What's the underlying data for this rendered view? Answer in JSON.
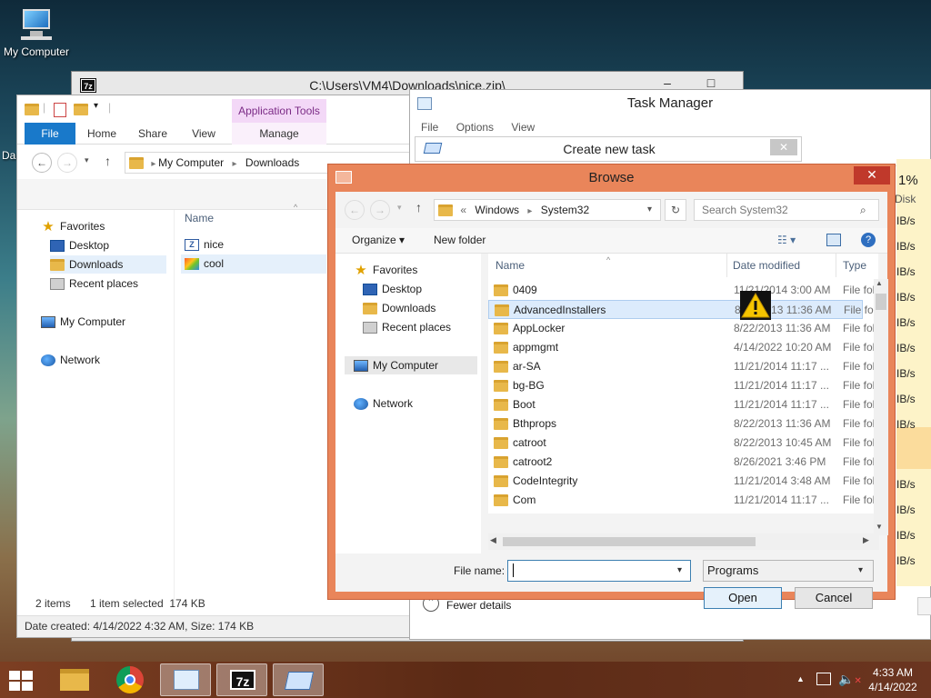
{
  "desktop": {
    "icon_label": "My Computer",
    "partial_label": "Da"
  },
  "zip_window": {
    "title": "C:\\Users\\VM4\\Downloads\\nice.zip\\",
    "logo": "7z"
  },
  "explorer": {
    "ribbon": {
      "context_group": "Application Tools",
      "tabs": [
        "File",
        "Home",
        "Share",
        "View",
        "Manage"
      ]
    },
    "breadcrumb": [
      "My Computer",
      "Downloads"
    ],
    "nav": {
      "favorites": "Favorites",
      "items": [
        "Desktop",
        "Downloads",
        "Recent places"
      ],
      "computer": "My Computer",
      "network": "Network"
    },
    "column_name": "Name",
    "files": [
      {
        "name": "nice",
        "icon": "zip-archive-icon"
      },
      {
        "name": "cool",
        "icon": "application-icon"
      }
    ],
    "status": {
      "count": "2 items",
      "selected": "1 item selected  174 KB"
    },
    "details": "Date created: 4/14/2022 4:32 AM, Size: 174 KB"
  },
  "task_manager": {
    "title": "Task Manager",
    "menu": [
      "File",
      "Options",
      "View"
    ],
    "disk_percent": "1%",
    "disk_label": "Disk",
    "speed_values": [
      "IB/s",
      "IB/s",
      "IB/s",
      "IB/s",
      "IB/s",
      "IB/s",
      "IB/s",
      "IB/s",
      "IB/s",
      "IB/s",
      "IB/s",
      "IB/s",
      "IB/s"
    ],
    "fewer_details": "Fewer details"
  },
  "create_task": {
    "title": "Create new task"
  },
  "browse": {
    "title": "Browse",
    "path": [
      "Windows",
      "System32"
    ],
    "path_prefix": "«",
    "search_placeholder": "Search System32",
    "organize": "Organize",
    "new_folder": "New folder",
    "nav": {
      "favorites": "Favorites",
      "items": [
        "Desktop",
        "Downloads",
        "Recent places"
      ],
      "computer": "My Computer",
      "network": "Network"
    },
    "columns": {
      "name": "Name",
      "date": "Date modified",
      "type": "Type"
    },
    "rows": [
      {
        "name": "0409",
        "date": "11/21/2014 3:00 AM",
        "type": "File fol"
      },
      {
        "name": "AdvancedInstallers",
        "date": "8/22/2013 11:36 AM",
        "type": "File fol"
      },
      {
        "name": "AppLocker",
        "date": "8/22/2013 11:36 AM",
        "type": "File fol"
      },
      {
        "name": "appmgmt",
        "date": "4/14/2022 10:20 AM",
        "type": "File fol"
      },
      {
        "name": "ar-SA",
        "date": "11/21/2014 11:17 ...",
        "type": "File fol"
      },
      {
        "name": "bg-BG",
        "date": "11/21/2014 11:17 ...",
        "type": "File fol"
      },
      {
        "name": "Boot",
        "date": "11/21/2014 11:17 ...",
        "type": "File fol"
      },
      {
        "name": "Bthprops",
        "date": "8/22/2013 11:36 AM",
        "type": "File fol"
      },
      {
        "name": "catroot",
        "date": "8/22/2013 10:45 AM",
        "type": "File fol"
      },
      {
        "name": "catroot2",
        "date": "8/26/2021 3:46 PM",
        "type": "File fol"
      },
      {
        "name": "CodeIntegrity",
        "date": "11/21/2014 3:48 AM",
        "type": "File fol"
      },
      {
        "name": "Com",
        "date": "11/21/2014 11:17 ...",
        "type": "File fol"
      }
    ],
    "file_name_label": "File name:",
    "file_name_value": "",
    "filter": "Programs",
    "open": "Open",
    "cancel": "Cancel"
  },
  "taskbar": {
    "time": "4:33 AM",
    "date": "4/14/2022"
  }
}
